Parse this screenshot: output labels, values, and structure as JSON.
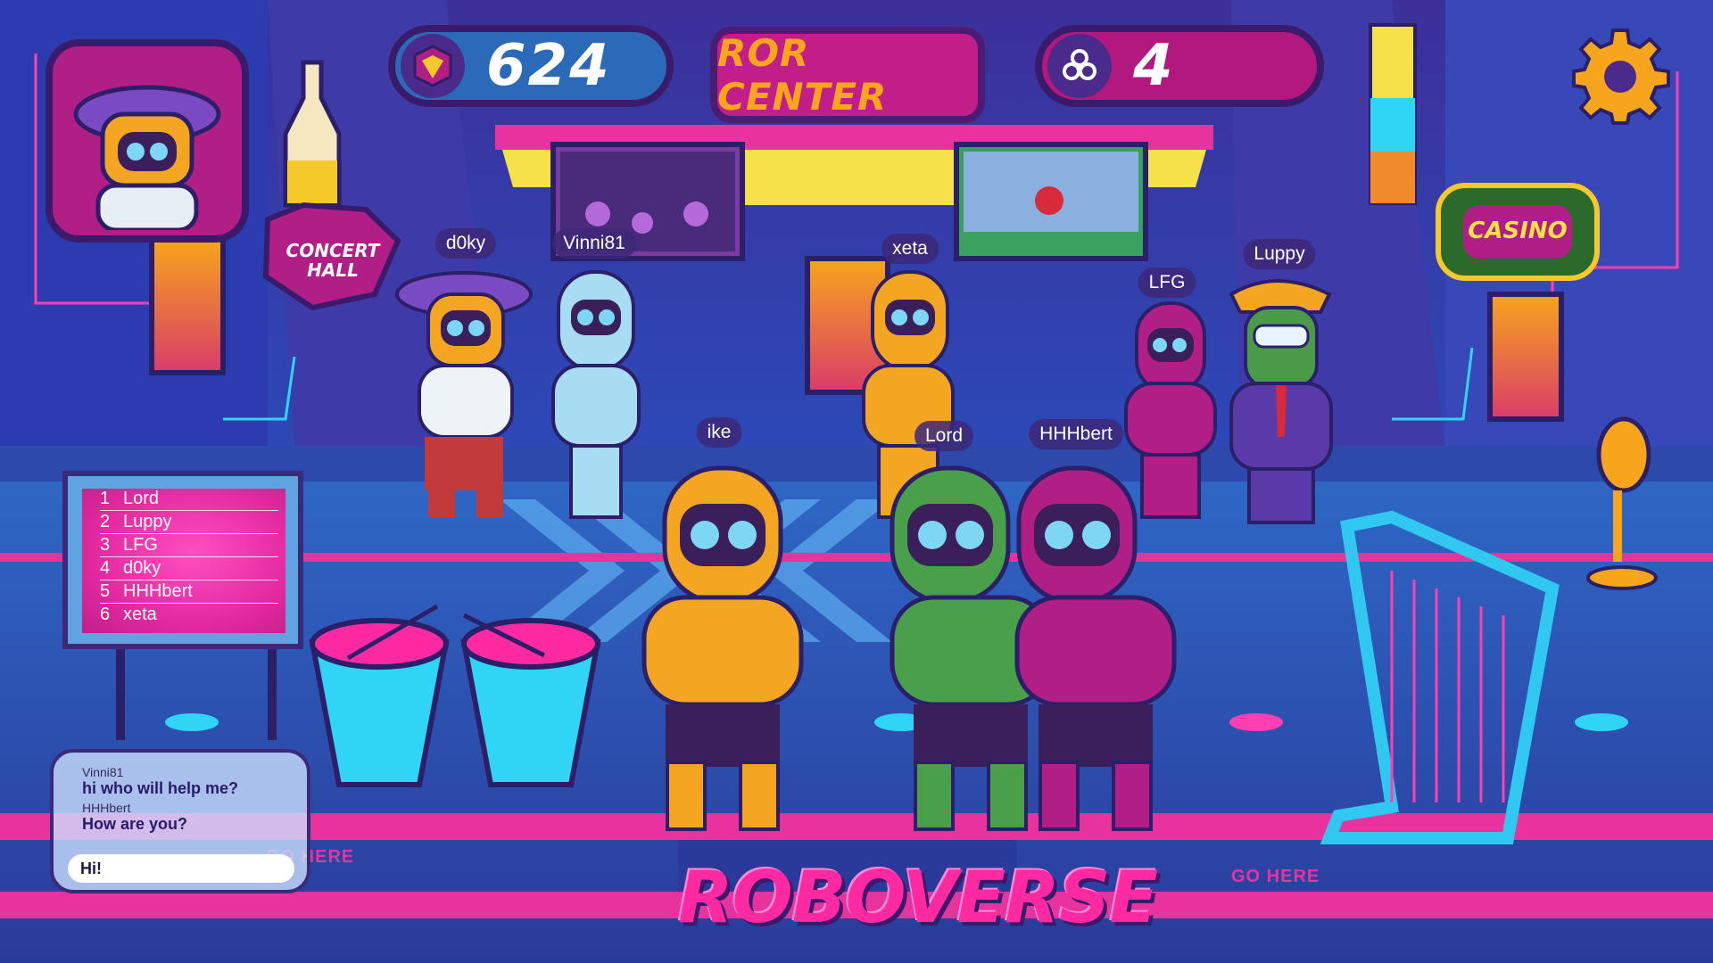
{
  "hud": {
    "score": "624",
    "tokens": "4",
    "center_sign": "ROR CENTER",
    "settings_icon": "gear-icon",
    "score_icon": "cube-icon",
    "token_icon": "clover-icon"
  },
  "signs": {
    "concert_hall": "CONCERT HALL",
    "casino": "CASINO",
    "go_here": "GO HERE",
    "logo": "ROBOVERSE"
  },
  "players": [
    {
      "name": "d0ky",
      "color": "#f4a622"
    },
    {
      "name": "Vinni81",
      "color": "#a8dcf2"
    },
    {
      "name": "xeta",
      "color": "#f4a622"
    },
    {
      "name": "LFG",
      "color": "#b11e86"
    },
    {
      "name": "Luppy",
      "color": "#4a9a4a"
    },
    {
      "name": "ike",
      "color": "#f4a622"
    },
    {
      "name": "Lord",
      "color": "#4aa04a"
    },
    {
      "name": "HHHbert",
      "color": "#b11e86"
    }
  ],
  "leaderboard": [
    {
      "rank": "1",
      "name": "Lord"
    },
    {
      "rank": "2",
      "name": "Luppy"
    },
    {
      "rank": "3",
      "name": "LFG"
    },
    {
      "rank": "4",
      "name": "d0ky"
    },
    {
      "rank": "5",
      "name": "HHHbert"
    },
    {
      "rank": "6",
      "name": "xeta"
    }
  ],
  "chat": {
    "messages": [
      {
        "user": "Vinni81",
        "text": "hi who will help me?"
      },
      {
        "user": "HHHbert",
        "text": "How are you?"
      }
    ],
    "input_value": "Hi!"
  },
  "colors": {
    "accent_pink": "#e8339f",
    "accent_orange": "#f7a51c",
    "background_blue": "#2a3a9a"
  }
}
